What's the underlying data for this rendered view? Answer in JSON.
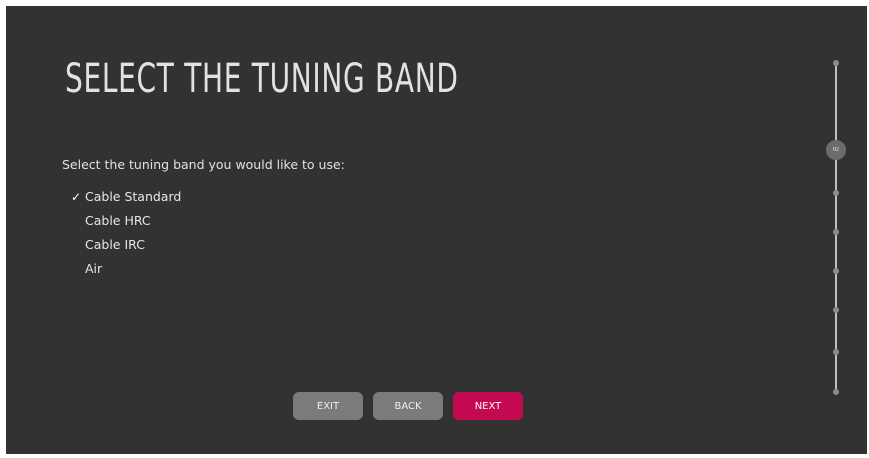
{
  "screen": {
    "title": "SELECT THE TUNING BAND",
    "prompt": "Select the tuning band you would like to use:"
  },
  "options": [
    {
      "label": "Cable Standard",
      "selected": true
    },
    {
      "label": "Cable HRC",
      "selected": false
    },
    {
      "label": "Cable IRC",
      "selected": false
    },
    {
      "label": "Air",
      "selected": false
    }
  ],
  "check_glyph": "✓",
  "buttons": {
    "exit": "EXIT",
    "back": "BACK",
    "next": "NEXT"
  },
  "progress": {
    "current_step_label": "02",
    "total_steps": 8,
    "current_step": 2
  },
  "colors": {
    "background": "#333233",
    "button_secondary": "#7b7a7c",
    "button_primary": "#c30a50"
  }
}
